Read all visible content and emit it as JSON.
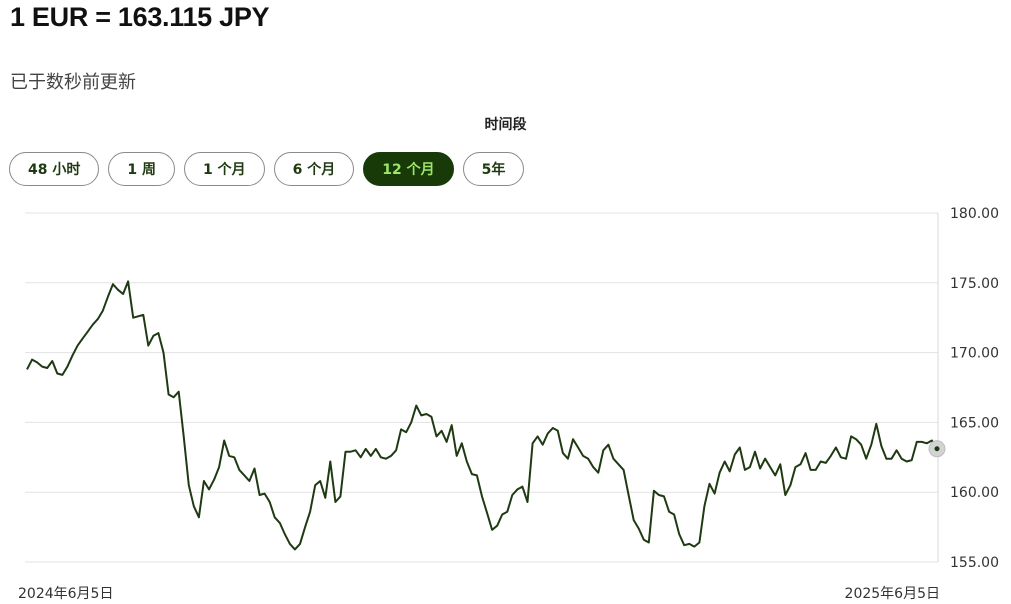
{
  "header": {
    "rate_title": "1 EUR = 163.115 JPY",
    "updated": "已于数秒前更新"
  },
  "periods": {
    "label": "时间段",
    "items": [
      {
        "label": "48 小时",
        "active": false
      },
      {
        "label": "1 周",
        "active": false
      },
      {
        "label": "1 个月",
        "active": false
      },
      {
        "label": "6 个月",
        "active": false
      },
      {
        "label": "12 个月",
        "active": true
      },
      {
        "label": "5年",
        "active": false
      }
    ]
  },
  "colors": {
    "line": "#1f3a12",
    "active_bg": "#173a08",
    "active_text": "#9ee66b",
    "grid": "#e3e3e3"
  },
  "chart_data": {
    "type": "line",
    "ylim": [
      155,
      180
    ],
    "y_ticks": [
      "155.00",
      "160.00",
      "165.00",
      "170.00",
      "175.00",
      "180.00"
    ],
    "x_tick_labels": [
      "2024年6月5日",
      "2025年6月5日"
    ],
    "grid": true,
    "series": [
      {
        "values": [
          168.8,
          169.5,
          169.3,
          169.0,
          168.9,
          169.4,
          168.5,
          168.4,
          169.0,
          169.8,
          170.5,
          171.0,
          171.5,
          172.0,
          172.4,
          173.0,
          174.0,
          174.9,
          174.5,
          174.2,
          175.1,
          172.5,
          172.6,
          172.7,
          170.5,
          171.2,
          171.4,
          170.0,
          167.0,
          166.8,
          167.2,
          164.0,
          160.5,
          159.0,
          158.2,
          160.8,
          160.2,
          160.9,
          161.8,
          163.7,
          162.6,
          162.5,
          161.6,
          161.2,
          160.8,
          161.7,
          159.8,
          159.9,
          159.3,
          158.2,
          157.8,
          157.0,
          156.3,
          155.9,
          156.3,
          157.5,
          158.6,
          160.5,
          160.8,
          159.6,
          162.2,
          159.3,
          159.7,
          162.9,
          162.9,
          163.0,
          162.5,
          163.1,
          162.6,
          163.1,
          162.5,
          162.4,
          162.6,
          163.0,
          164.5,
          164.3,
          165.0,
          166.2,
          165.5,
          165.6,
          165.4,
          164.0,
          164.4,
          163.6,
          164.8,
          162.6,
          163.5,
          162.2,
          161.3,
          161.2,
          159.7,
          158.5,
          157.3,
          157.6,
          158.4,
          158.6,
          159.8,
          160.2,
          160.4,
          159.3,
          163.5,
          164.0,
          163.4,
          164.2,
          164.6,
          164.4,
          162.8,
          162.4,
          163.8,
          163.2,
          162.6,
          162.4,
          161.8,
          161.4,
          163.0,
          163.4,
          162.4,
          162.0,
          161.6,
          159.8,
          158.0,
          157.4,
          156.6,
          156.4,
          160.1,
          159.8,
          159.7,
          158.6,
          158.4,
          157.0,
          156.2,
          156.3,
          156.1,
          156.4,
          159.0,
          160.6,
          159.9,
          161.4,
          162.2,
          161.5,
          162.7,
          163.2,
          161.6,
          161.8,
          162.9,
          161.7,
          162.4,
          161.8,
          161.2,
          162.0,
          159.8,
          160.5,
          161.8,
          162.0,
          162.8,
          161.6,
          161.6,
          162.2,
          162.1,
          162.6,
          163.2,
          162.5,
          162.4,
          164.0,
          163.8,
          163.4,
          162.4,
          163.4,
          164.9,
          163.3,
          162.4,
          162.4,
          163.0,
          162.4,
          162.2,
          162.3,
          163.6,
          163.6,
          163.5,
          163.7,
          163.1
        ]
      }
    ],
    "current_value": 163.115
  }
}
